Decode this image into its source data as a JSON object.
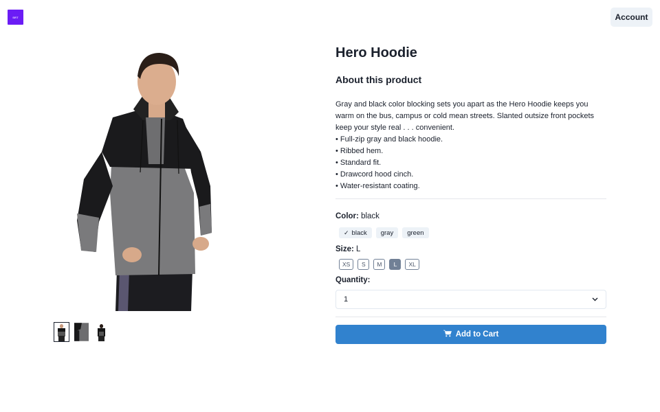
{
  "header": {
    "logo_text": "SRT",
    "account_label": "Account"
  },
  "gallery": {
    "thumbnails": [
      "front-view",
      "back-detail-view",
      "back-view"
    ],
    "selected_index": 0
  },
  "product": {
    "title": "Hero Hoodie",
    "about_heading": "About this product",
    "description": "Gray and black color blocking sets you apart as the Hero Hoodie keeps you warm on the bus, campus or cold mean streets. Slanted outsize front pockets keep your style real . . . convenient.",
    "bullets": [
      "• Full-zip gray and black hoodie.",
      "• Ribbed hem.",
      "• Standard fit.",
      "• Drawcord hood cinch.",
      "• Water-resistant coating."
    ],
    "color": {
      "label": "Color:",
      "value": "black",
      "options": [
        "black",
        "gray",
        "green"
      ]
    },
    "size": {
      "label": "Size:",
      "value": "L",
      "options": [
        "XS",
        "S",
        "M",
        "L",
        "XL"
      ]
    },
    "quantity": {
      "label": "Quantity:",
      "value": "1"
    },
    "add_to_cart_label": "Add to Cart"
  },
  "colors": {
    "accent": "#3182ce",
    "logo": "#6b1cf5",
    "selected_size": "#718096"
  }
}
